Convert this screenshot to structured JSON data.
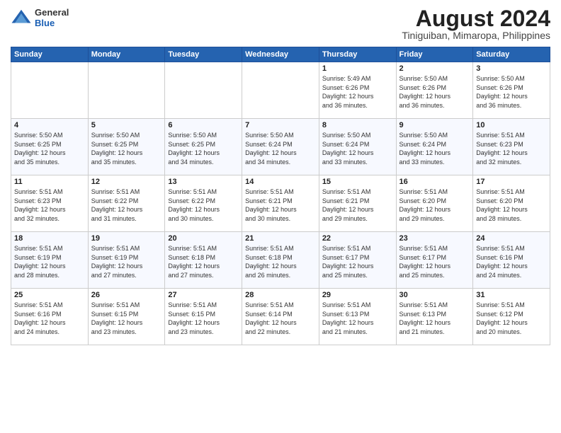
{
  "logo": {
    "general": "General",
    "blue": "Blue"
  },
  "title": "August 2024",
  "subtitle": "Tiniguiban, Mimaropa, Philippines",
  "weekdays": [
    "Sunday",
    "Monday",
    "Tuesday",
    "Wednesday",
    "Thursday",
    "Friday",
    "Saturday"
  ],
  "weeks": [
    [
      {
        "day": "",
        "info": ""
      },
      {
        "day": "",
        "info": ""
      },
      {
        "day": "",
        "info": ""
      },
      {
        "day": "",
        "info": ""
      },
      {
        "day": "1",
        "info": "Sunrise: 5:49 AM\nSunset: 6:26 PM\nDaylight: 12 hours\nand 36 minutes."
      },
      {
        "day": "2",
        "info": "Sunrise: 5:50 AM\nSunset: 6:26 PM\nDaylight: 12 hours\nand 36 minutes."
      },
      {
        "day": "3",
        "info": "Sunrise: 5:50 AM\nSunset: 6:26 PM\nDaylight: 12 hours\nand 36 minutes."
      }
    ],
    [
      {
        "day": "4",
        "info": "Sunrise: 5:50 AM\nSunset: 6:25 PM\nDaylight: 12 hours\nand 35 minutes."
      },
      {
        "day": "5",
        "info": "Sunrise: 5:50 AM\nSunset: 6:25 PM\nDaylight: 12 hours\nand 35 minutes."
      },
      {
        "day": "6",
        "info": "Sunrise: 5:50 AM\nSunset: 6:25 PM\nDaylight: 12 hours\nand 34 minutes."
      },
      {
        "day": "7",
        "info": "Sunrise: 5:50 AM\nSunset: 6:24 PM\nDaylight: 12 hours\nand 34 minutes."
      },
      {
        "day": "8",
        "info": "Sunrise: 5:50 AM\nSunset: 6:24 PM\nDaylight: 12 hours\nand 33 minutes."
      },
      {
        "day": "9",
        "info": "Sunrise: 5:50 AM\nSunset: 6:24 PM\nDaylight: 12 hours\nand 33 minutes."
      },
      {
        "day": "10",
        "info": "Sunrise: 5:51 AM\nSunset: 6:23 PM\nDaylight: 12 hours\nand 32 minutes."
      }
    ],
    [
      {
        "day": "11",
        "info": "Sunrise: 5:51 AM\nSunset: 6:23 PM\nDaylight: 12 hours\nand 32 minutes."
      },
      {
        "day": "12",
        "info": "Sunrise: 5:51 AM\nSunset: 6:22 PM\nDaylight: 12 hours\nand 31 minutes."
      },
      {
        "day": "13",
        "info": "Sunrise: 5:51 AM\nSunset: 6:22 PM\nDaylight: 12 hours\nand 30 minutes."
      },
      {
        "day": "14",
        "info": "Sunrise: 5:51 AM\nSunset: 6:21 PM\nDaylight: 12 hours\nand 30 minutes."
      },
      {
        "day": "15",
        "info": "Sunrise: 5:51 AM\nSunset: 6:21 PM\nDaylight: 12 hours\nand 29 minutes."
      },
      {
        "day": "16",
        "info": "Sunrise: 5:51 AM\nSunset: 6:20 PM\nDaylight: 12 hours\nand 29 minutes."
      },
      {
        "day": "17",
        "info": "Sunrise: 5:51 AM\nSunset: 6:20 PM\nDaylight: 12 hours\nand 28 minutes."
      }
    ],
    [
      {
        "day": "18",
        "info": "Sunrise: 5:51 AM\nSunset: 6:19 PM\nDaylight: 12 hours\nand 28 minutes."
      },
      {
        "day": "19",
        "info": "Sunrise: 5:51 AM\nSunset: 6:19 PM\nDaylight: 12 hours\nand 27 minutes."
      },
      {
        "day": "20",
        "info": "Sunrise: 5:51 AM\nSunset: 6:18 PM\nDaylight: 12 hours\nand 27 minutes."
      },
      {
        "day": "21",
        "info": "Sunrise: 5:51 AM\nSunset: 6:18 PM\nDaylight: 12 hours\nand 26 minutes."
      },
      {
        "day": "22",
        "info": "Sunrise: 5:51 AM\nSunset: 6:17 PM\nDaylight: 12 hours\nand 25 minutes."
      },
      {
        "day": "23",
        "info": "Sunrise: 5:51 AM\nSunset: 6:17 PM\nDaylight: 12 hours\nand 25 minutes."
      },
      {
        "day": "24",
        "info": "Sunrise: 5:51 AM\nSunset: 6:16 PM\nDaylight: 12 hours\nand 24 minutes."
      }
    ],
    [
      {
        "day": "25",
        "info": "Sunrise: 5:51 AM\nSunset: 6:16 PM\nDaylight: 12 hours\nand 24 minutes."
      },
      {
        "day": "26",
        "info": "Sunrise: 5:51 AM\nSunset: 6:15 PM\nDaylight: 12 hours\nand 23 minutes."
      },
      {
        "day": "27",
        "info": "Sunrise: 5:51 AM\nSunset: 6:15 PM\nDaylight: 12 hours\nand 23 minutes."
      },
      {
        "day": "28",
        "info": "Sunrise: 5:51 AM\nSunset: 6:14 PM\nDaylight: 12 hours\nand 22 minutes."
      },
      {
        "day": "29",
        "info": "Sunrise: 5:51 AM\nSunset: 6:13 PM\nDaylight: 12 hours\nand 21 minutes."
      },
      {
        "day": "30",
        "info": "Sunrise: 5:51 AM\nSunset: 6:13 PM\nDaylight: 12 hours\nand 21 minutes."
      },
      {
        "day": "31",
        "info": "Sunrise: 5:51 AM\nSunset: 6:12 PM\nDaylight: 12 hours\nand 20 minutes."
      }
    ]
  ]
}
